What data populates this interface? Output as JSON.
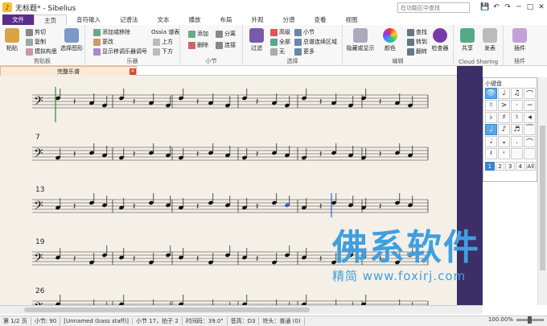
{
  "window": {
    "title": "无标题* - Sibelius",
    "search_placeholder": "在功能区中查找"
  },
  "tabs": [
    "文件",
    "主页",
    "音符输入",
    "记谱法",
    "文本",
    "播放",
    "布局",
    "外观",
    "分谱",
    "查看",
    "视图"
  ],
  "active_tab": "主页",
  "ribbon": {
    "clipboard": {
      "label": "剪贴板",
      "paste": "粘贴",
      "cut": "剪切",
      "copy": "复制",
      "capture": "摸拟构思",
      "select_graphic": "选择图形"
    },
    "instruments": {
      "label": "乐器",
      "add_remove": "添加或移除",
      "change": "更改",
      "show_hide": "显示移调乐器调号",
      "ossia": "Ossia 谱表",
      "above": "上方",
      "below": "下方"
    },
    "bars": {
      "label": "小节",
      "add": "添加",
      "delete": "删除",
      "split": "分离",
      "join": "连接"
    },
    "selection": {
      "label": "选择",
      "filter": "过滤",
      "advanced": "高级",
      "all": "全部",
      "none": "无",
      "bar": "小节",
      "system_passage": "总谱连续区域",
      "more": "更多"
    },
    "edit": {
      "label": "编辑",
      "hide_show": "隐藏或显示",
      "color": "颜色",
      "find": "查找",
      "goto": "转到",
      "flip": "翻转",
      "inspector": "检查器"
    },
    "cloud": {
      "label": "Cloud Sharing",
      "share": "共享",
      "publish": "发表"
    },
    "plugins": {
      "label": "插件",
      "plugin": "插件"
    }
  },
  "doc_tab": {
    "label": "完整乐谱",
    "close": "✕"
  },
  "score": {
    "measure_numbers": [
      "7",
      "13",
      "19",
      "26"
    ],
    "clef": "𝄢"
  },
  "keypad": {
    "title": "小键盘",
    "pages": [
      "1",
      "2",
      "3",
      "4",
      "All"
    ]
  },
  "status": {
    "page": "第 1/2 页",
    "bars": "小节: 90",
    "staff": "[Unnamed (bass staff)]",
    "position": "小节 17，拍子 2",
    "timecode": "时间码：39.0\"",
    "pitch": "音高：D3",
    "beams": "符头：普通 (0)"
  },
  "zoom": {
    "value": "100.00%"
  },
  "watermark": {
    "big": "佛系软件",
    "small": "精简 www.foxirj.com"
  },
  "colors": {
    "accent": "#5b2c8a",
    "panel": "#3c2e66",
    "select": "#5aa7e8"
  }
}
